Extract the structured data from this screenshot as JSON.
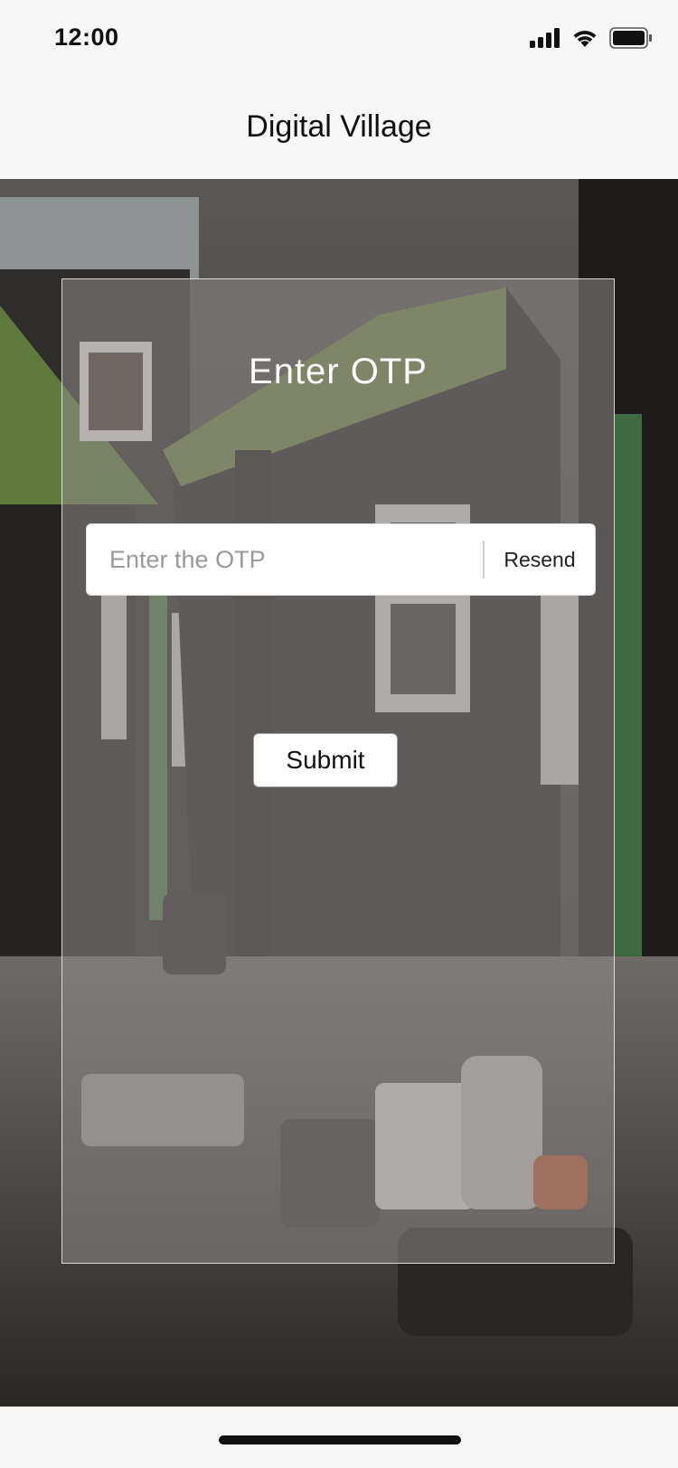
{
  "status_bar": {
    "time": "12:00",
    "icons": [
      "cellular-signal-icon",
      "wifi-icon",
      "battery-icon"
    ]
  },
  "header": {
    "title": "Digital Village"
  },
  "otp_form": {
    "title": "Enter OTP",
    "input_placeholder": "Enter the OTP",
    "input_value": "",
    "resend_label": "Resend",
    "submit_label": "Submit"
  },
  "colors": {
    "background": "#f7f7f7",
    "card_overlay": "#8c8886",
    "card_border": "#ffffff",
    "text_dark": "#111111",
    "placeholder": "#9a9a9a"
  }
}
